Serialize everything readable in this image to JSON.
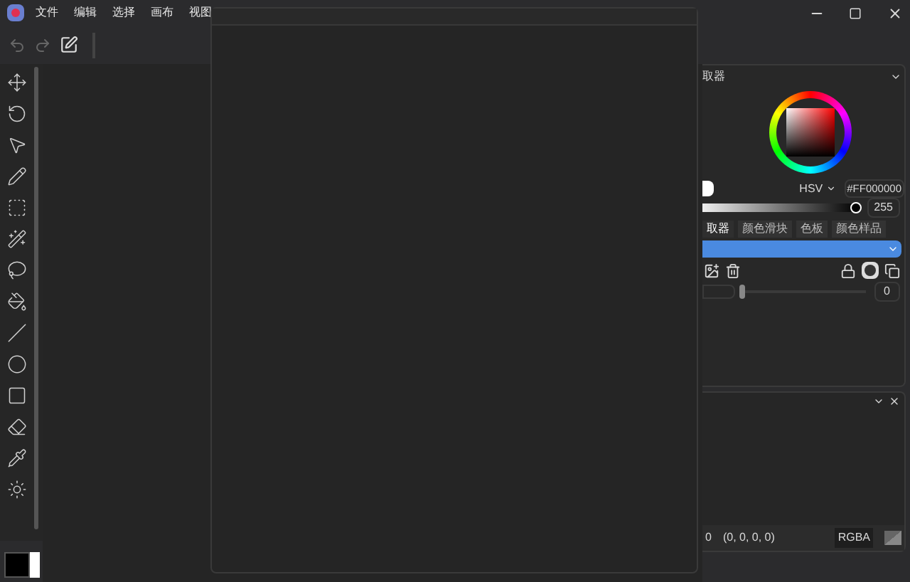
{
  "menu": [
    {
      "label": "文件"
    },
    {
      "label": "编辑"
    },
    {
      "label": "选择"
    },
    {
      "label": "画布"
    },
    {
      "label": "视图"
    }
  ],
  "picker": {
    "title": "取器",
    "mode": "HSV",
    "hex": "#FF000000",
    "alpha": "255",
    "alpha_slider": {
      "level": 1
    }
  },
  "tabs": [
    {
      "label": "取器",
      "selected": true
    },
    {
      "label": "颜色滑块",
      "selected": false
    },
    {
      "label": "色板",
      "selected": false
    },
    {
      "label": "颜色样品",
      "selected": false
    }
  ],
  "layers": {
    "opacity": "0",
    "opacity_slider": {
      "level": 0
    }
  },
  "info": {
    "value": "0",
    "rgba": "(0, 0, 0, 0)",
    "format": "RGBA"
  }
}
